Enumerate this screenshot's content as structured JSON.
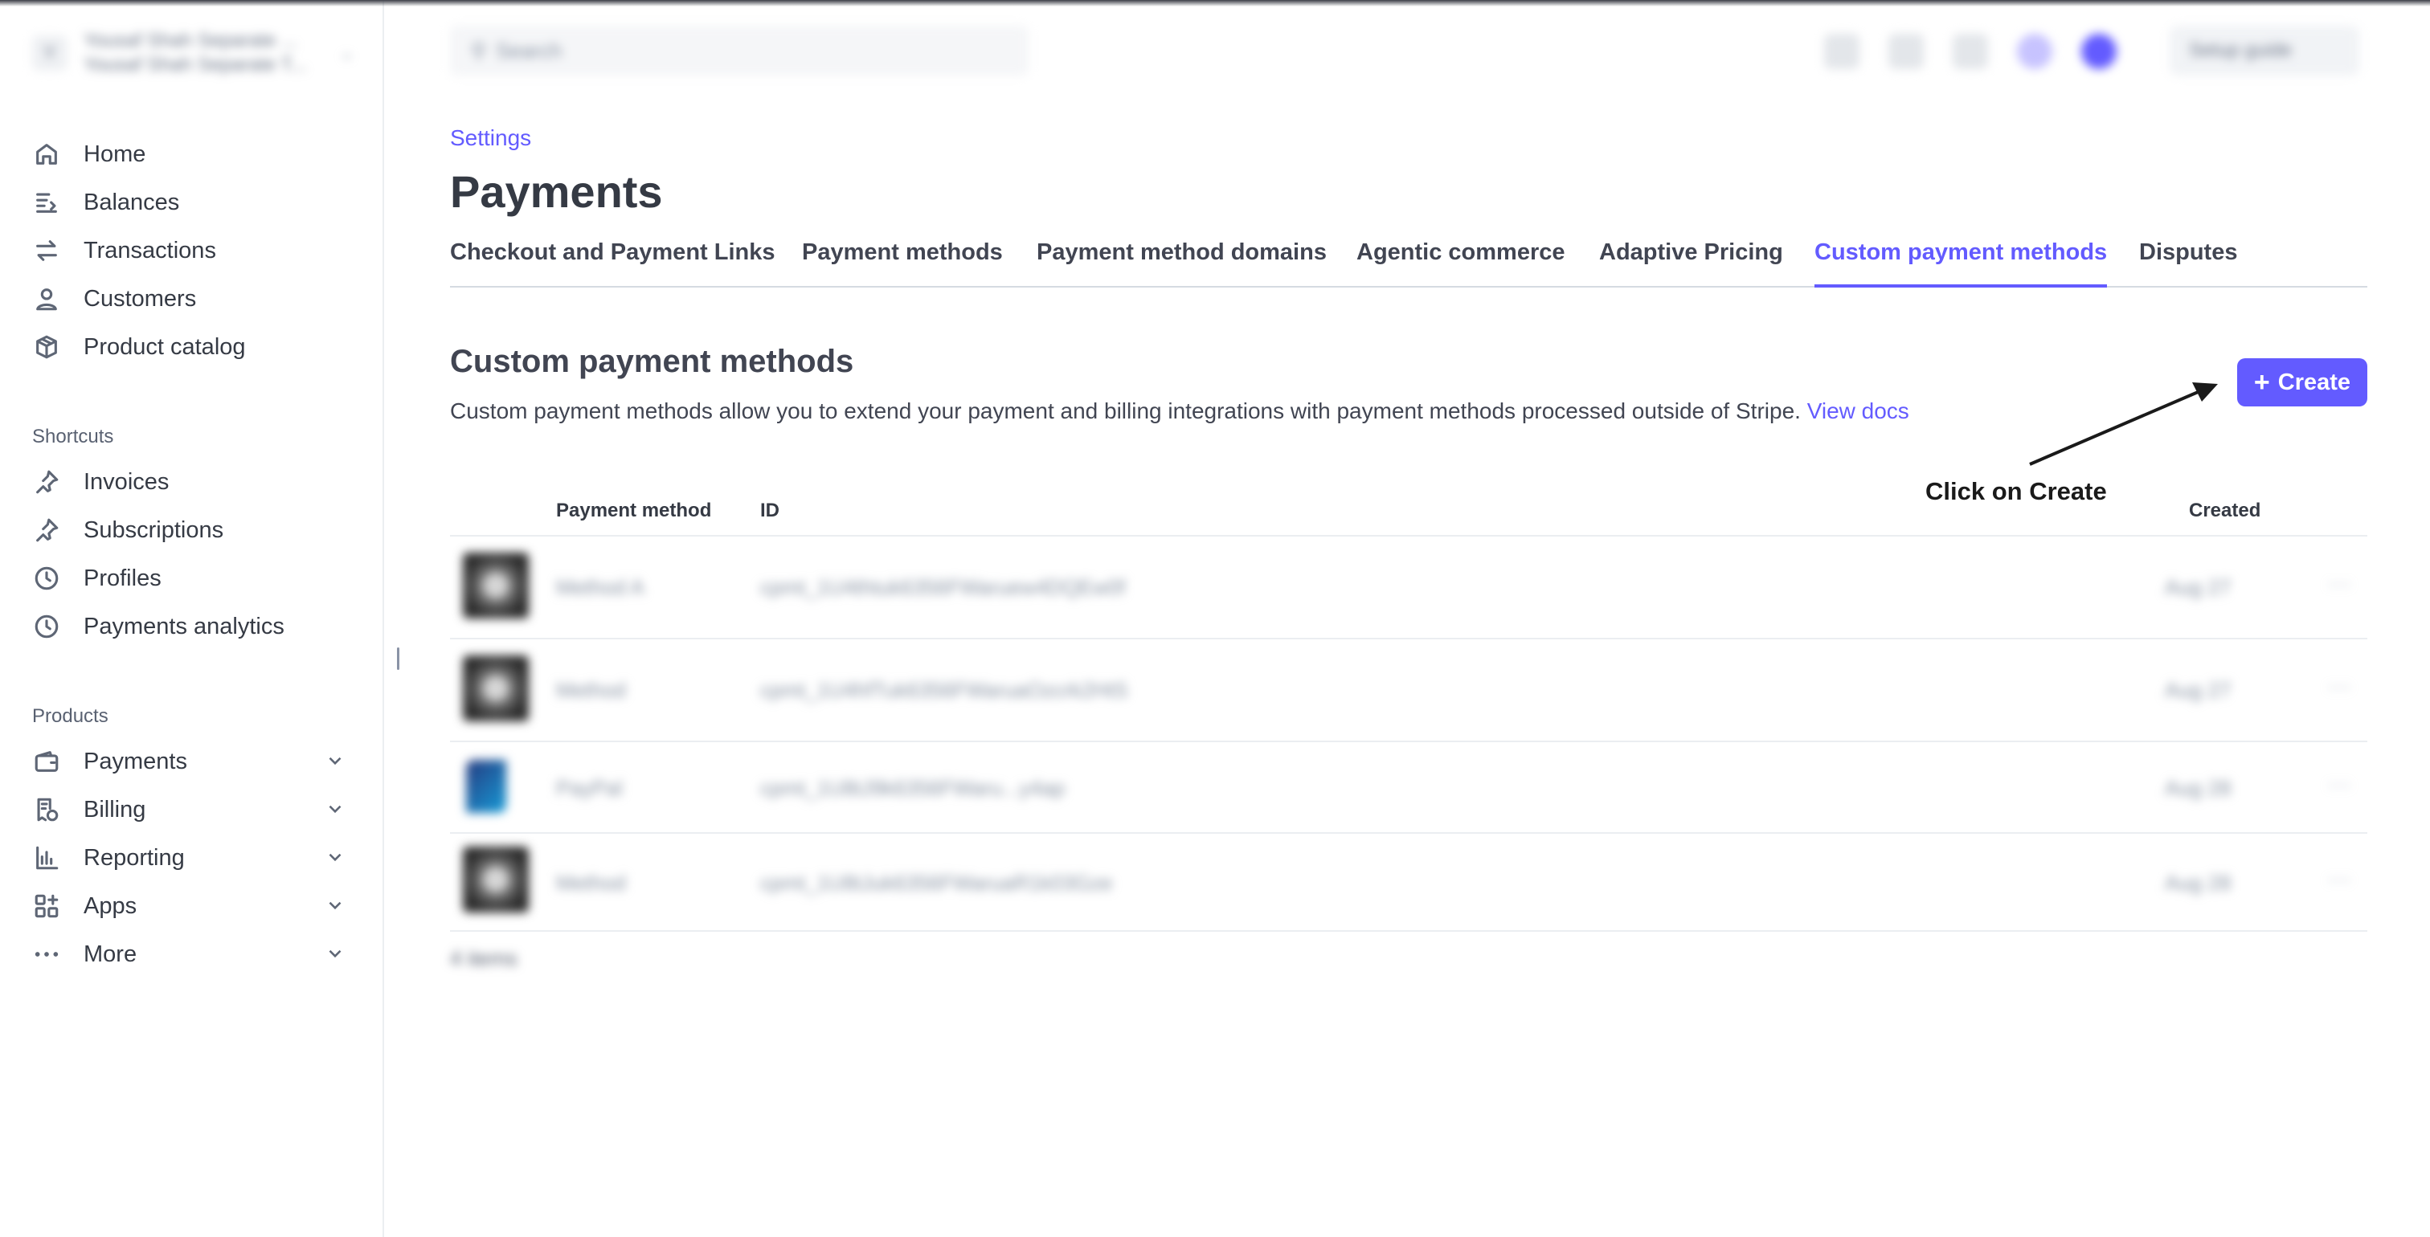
{
  "account": {
    "initial": "Y",
    "name_line1": "Yousaf Shah Separate ...",
    "name_line2": "Yousaf Shah Separate T..."
  },
  "sidebar": {
    "main_items": [
      {
        "label": "Home",
        "icon": "home-icon"
      },
      {
        "label": "Balances",
        "icon": "balances-icon"
      },
      {
        "label": "Transactions",
        "icon": "transactions-icon"
      },
      {
        "label": "Customers",
        "icon": "customers-icon"
      },
      {
        "label": "Product catalog",
        "icon": "product-catalog-icon"
      }
    ],
    "shortcuts_label": "Shortcuts",
    "shortcuts": [
      {
        "label": "Invoices",
        "icon": "pin-icon"
      },
      {
        "label": "Subscriptions",
        "icon": "pin-icon"
      },
      {
        "label": "Profiles",
        "icon": "clock-icon"
      },
      {
        "label": "Payments analytics",
        "icon": "clock-icon"
      }
    ],
    "products_label": "Products",
    "products": [
      {
        "label": "Payments",
        "icon": "wallet-icon"
      },
      {
        "label": "Billing",
        "icon": "billing-icon"
      },
      {
        "label": "Reporting",
        "icon": "reporting-icon"
      },
      {
        "label": "Apps",
        "icon": "apps-icon"
      },
      {
        "label": "More",
        "icon": "more-icon"
      }
    ]
  },
  "topbar": {
    "search_placeholder": "Search",
    "setup_guide_label": "Setup guide"
  },
  "page": {
    "breadcrumb": "Settings",
    "title": "Payments",
    "tabs": [
      {
        "label": "Checkout and Payment Links",
        "active": false
      },
      {
        "label": "Payment methods",
        "active": false
      },
      {
        "label": "Payment method domains",
        "active": false
      },
      {
        "label": "Agentic commerce",
        "active": false
      },
      {
        "label": "Adaptive Pricing",
        "active": false
      },
      {
        "label": "Custom payment methods",
        "active": true
      },
      {
        "label": "Disputes",
        "active": false
      }
    ],
    "section_title": "Custom payment methods",
    "section_description": "Custom payment methods allow you to extend your payment and billing integrations with payment methods processed outside of Stripe.",
    "view_docs_link": "View docs",
    "create_button": "Create",
    "annotation": "Click on Create"
  },
  "table": {
    "columns": {
      "payment_method": "Payment method",
      "id": "ID",
      "created": "Created"
    },
    "rows": [
      {
        "name": "Method A",
        "id": "cpmt_1U4thtuk6356FWaruew4DQEw0f",
        "created": "Aug 27",
        "thumb": "dark"
      },
      {
        "name": "Method",
        "id": "cpmt_1U4hfTuk6356FWaruaOzcrk2HtS",
        "created": "Aug 27",
        "thumb": "dark"
      },
      {
        "name": "PayPal",
        "id": "cpmt_1U8tJ9k6356FWaru...y4ap",
        "created": "Aug 28",
        "thumb": "paypal"
      },
      {
        "name": "Method",
        "id": "cpmt_1U8tJuk6356FWaruaR1k03Gze",
        "created": "Aug 28",
        "thumb": "dark"
      }
    ],
    "count_label": "4 items"
  }
}
